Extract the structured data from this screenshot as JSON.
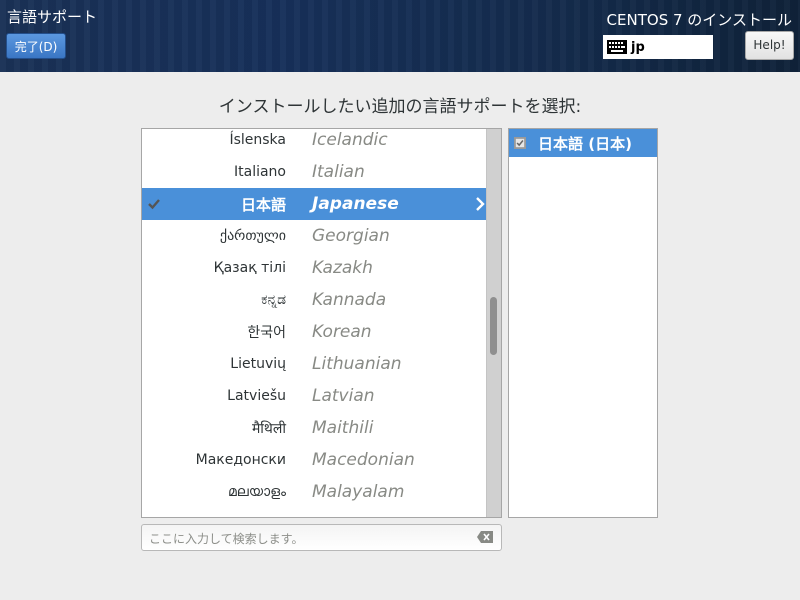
{
  "header": {
    "spoke_title": "言語サポート",
    "done_button": "完了(D)",
    "product_title": "CENTOS 7 のインストール",
    "keyboard_layout": "jp",
    "help_button": "Help!"
  },
  "prompt": "インストールしたい追加の言語サポートを選択:",
  "languages": [
    {
      "native": "Íslenska",
      "english": "Icelandic",
      "selected": false
    },
    {
      "native": "Italiano",
      "english": "Italian",
      "selected": false
    },
    {
      "native": "日本語",
      "english": "Japanese",
      "selected": true
    },
    {
      "native": "ქართული",
      "english": "Georgian",
      "selected": false
    },
    {
      "native": "Қазақ тілі",
      "english": "Kazakh",
      "selected": false
    },
    {
      "native": "ಕನ್ನಡ",
      "english": "Kannada",
      "selected": false
    },
    {
      "native": "한국어",
      "english": "Korean",
      "selected": false
    },
    {
      "native": "Lietuvių",
      "english": "Lithuanian",
      "selected": false
    },
    {
      "native": "Latviešu",
      "english": "Latvian",
      "selected": false
    },
    {
      "native": "मैथिली",
      "english": "Maithili",
      "selected": false
    },
    {
      "native": "Македонски",
      "english": "Macedonian",
      "selected": false
    },
    {
      "native": "മലയാളം",
      "english": "Malayalam",
      "selected": false
    }
  ],
  "locales": [
    {
      "label": "日本語 (日本)",
      "checked": true
    }
  ],
  "search": {
    "placeholder": "ここに入力して検索します。",
    "value": ""
  },
  "colors": {
    "selection": "#4a90d9",
    "header_bg": "#17305a"
  }
}
